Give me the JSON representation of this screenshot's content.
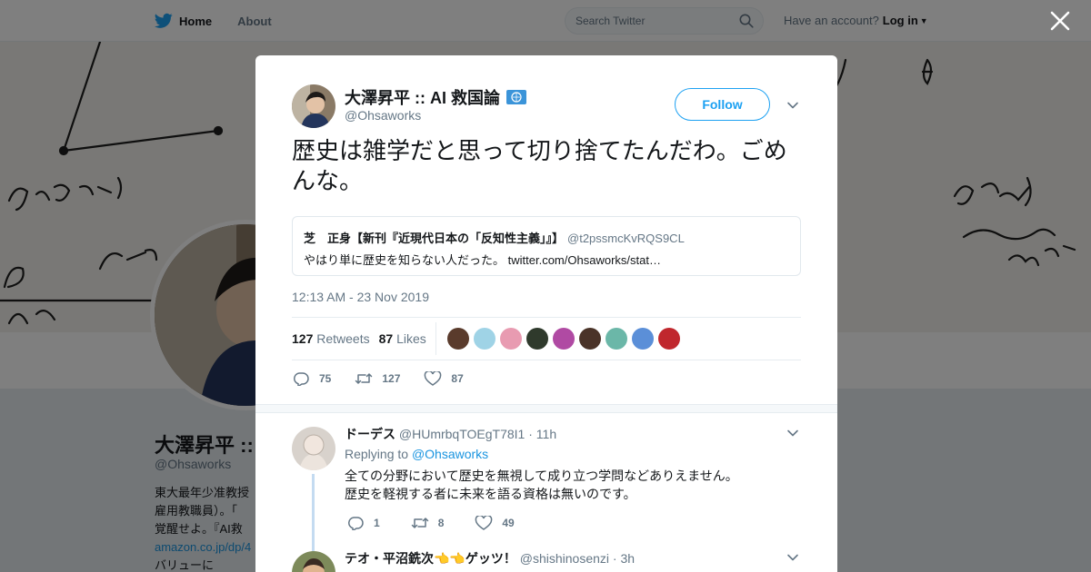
{
  "nav": {
    "home_label": "Home",
    "about_label": "About",
    "search_placeholder": "Search Twitter",
    "account_prompt": "Have an account?",
    "login_label": "Log in"
  },
  "profile": {
    "name": "大澤昇平 ::",
    "handle": "@Ohsaworks",
    "bio_lines": [
      "東大最年少准教授",
      "雇用教職員）。「",
      "覚醒せよ。『AI救"
    ],
    "bio_link": "amazon.co.jp/dp/4",
    "bio_tail": "バリューに"
  },
  "tweet": {
    "author_name": "大澤昇平 :: AI 救国論",
    "author_handle": "@Ohsaworks",
    "follow_label": "Follow",
    "text": "歴史は雑学だと思って切り捨てたんだわ。ごめんな。",
    "quote": {
      "name": "芝　正身【新刊『近現代日本の「反知性主義」』】",
      "handle": "@t2pssmcKvRQS9CL",
      "text": "やはり単に歴史を知らない人だった。",
      "link": "twitter.com/Ohsaworks/stat…"
    },
    "timestamp": "12:13 AM - 23 Nov 2019",
    "retweets_count": "127",
    "retweets_label": "Retweets",
    "likes_count": "87",
    "likes_label": "Likes",
    "action_counts": {
      "reply": "75",
      "retweet": "127",
      "like": "87"
    },
    "liker_colors": [
      "#5a3b2c",
      "#9fd3e6",
      "#e89bb1",
      "#2f3a2c",
      "#b04aa3",
      "#4a3328",
      "#6bb7a8",
      "#5b8fd8",
      "#c0272d"
    ]
  },
  "replies": [
    {
      "name": "ドーデス",
      "handle": "@HUmrbqTOEgT78I1",
      "time": "· 11h",
      "replying_prefix": "Replying to",
      "replying_to": "@Ohsaworks",
      "lines": [
        "全ての分野において歴史を無視して成り立つ学問などありえません。",
        "歴史を軽視する者に未来を語る資格は無いのです。"
      ],
      "counts": {
        "reply": "1",
        "retweet": "8",
        "like": "49"
      }
    },
    {
      "name": "テオ・平沼銑次👈👈ゲッツ！",
      "handle": "@shishinosenzi",
      "time": "· 3h"
    }
  ],
  "icons": {
    "logo": "twitter-bird-icon",
    "search": "search-icon",
    "close": "close-icon",
    "chevron": "chevron-down-icon",
    "reply": "reply-icon",
    "retweet": "retweet-icon",
    "like": "heart-icon",
    "verified": "verified-badge-icon"
  },
  "colors": {
    "accent": "#1da1f2",
    "link": "#1b95e0",
    "muted": "#657786"
  }
}
